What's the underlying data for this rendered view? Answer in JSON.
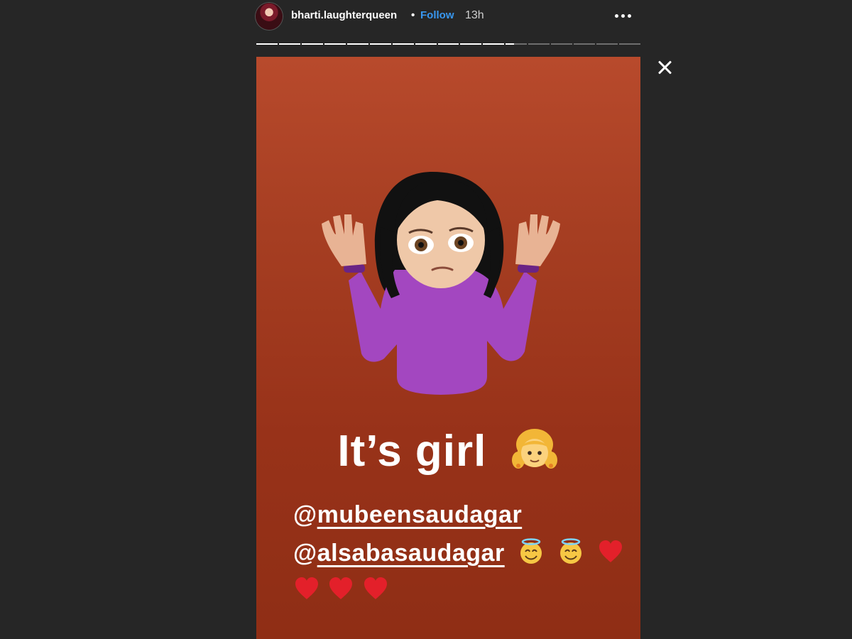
{
  "header": {
    "username": "bharti.laughterqueen",
    "separator": "•",
    "follow_label": "Follow",
    "time": "13h",
    "more_icon": "more-horizontal-icon"
  },
  "progress": {
    "segments_total": 17,
    "segments_complete": 11,
    "current_segment_fill": 0.4,
    "fill_color": "#ffffff",
    "track_color": "#6e6e6e"
  },
  "close_icon": "close-icon",
  "story": {
    "background_top": "#b84a2c",
    "background_bottom": "#8f2e15",
    "sticker": "woman-shrugging-emoji",
    "caption": "It’s girl",
    "caption_emoji": "girl-emoji",
    "mentions": [
      {
        "prefix": "@",
        "handle": "mubeensaudagar"
      },
      {
        "prefix": "@",
        "handle": "alsabasaudagar"
      }
    ],
    "trailing_emojis": [
      "smiling-face-with-halo-emoji",
      "smiling-face-with-halo-emoji",
      "red-heart-emoji"
    ],
    "last_row_emojis": [
      "red-heart-emoji",
      "red-heart-emoji",
      "red-heart-emoji"
    ]
  },
  "colors": {
    "page_bg": "#262626",
    "follow_blue": "#3897f0",
    "sweater_purple": "#a347c0"
  }
}
